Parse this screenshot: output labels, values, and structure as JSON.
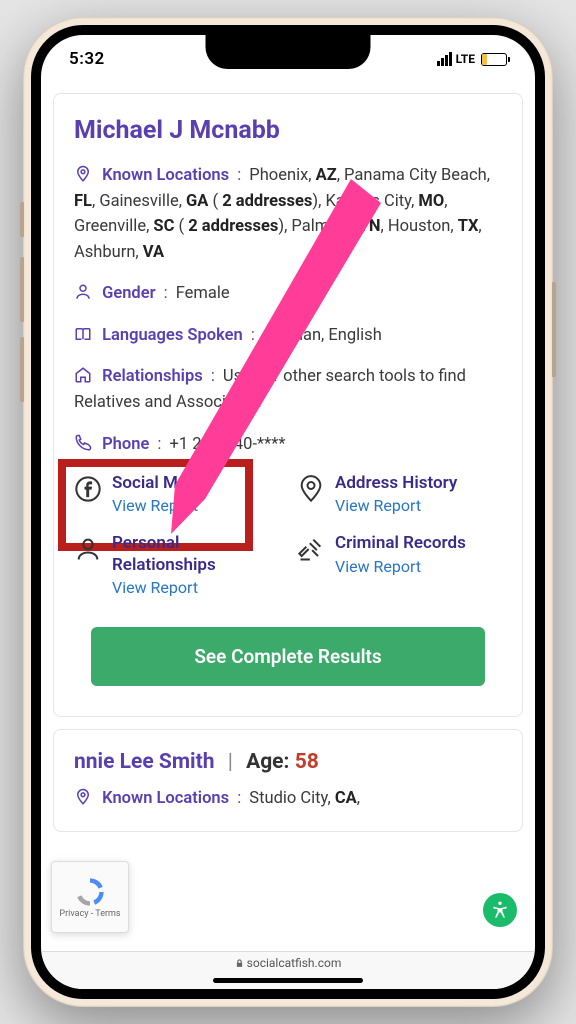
{
  "status": {
    "time": "5:32",
    "network": "LTE"
  },
  "person": {
    "name": "Michael J Mcnabb",
    "knownLocationsLabel": "Known Locations",
    "locationsHtml": "Phoenix, <b>AZ</b>, Panama City Beach, <b>FL</b>,  Gainesville, <b>GA</b> ( <b>2 addresses</b>),  Kansas City, <b>MO</b>,  Greenville, <b>SC</b> ( <b>2 addresses</b>),  Palmyra, <b>TN</b>,  Houston, <b>TX</b>, Ashburn, <b>VA</b>",
    "genderLabel": "Gender",
    "gender": "Female",
    "languagesLabel": "Languages Spoken",
    "languages": "German, English",
    "relationshipsLabel": "Relationships",
    "relationshipsText": "Use our other search tools to find Relatives and Associates.",
    "phoneLabel": "Phone",
    "phone": "+1 212-640-****"
  },
  "tiles": {
    "socialMedia": {
      "title": "Social Media",
      "link": "View Report"
    },
    "addressHistory": {
      "title": "Address History",
      "link": "View Report"
    },
    "personalRelationships": {
      "title": "Personal Relationships",
      "link": "View Report"
    },
    "criminalRecords": {
      "title": "Criminal Records",
      "link": "View Report"
    }
  },
  "cta": "See Complete Results",
  "second": {
    "nameFragment": "nnie Lee Smith",
    "ageLabel": "Age:",
    "age": "58",
    "knownLocationsLabel": "Known Locations",
    "locationsFragment": "Studio City, CA,"
  },
  "recaptcha": "Privacy  -  Terms",
  "url": "socialcatfish.com"
}
